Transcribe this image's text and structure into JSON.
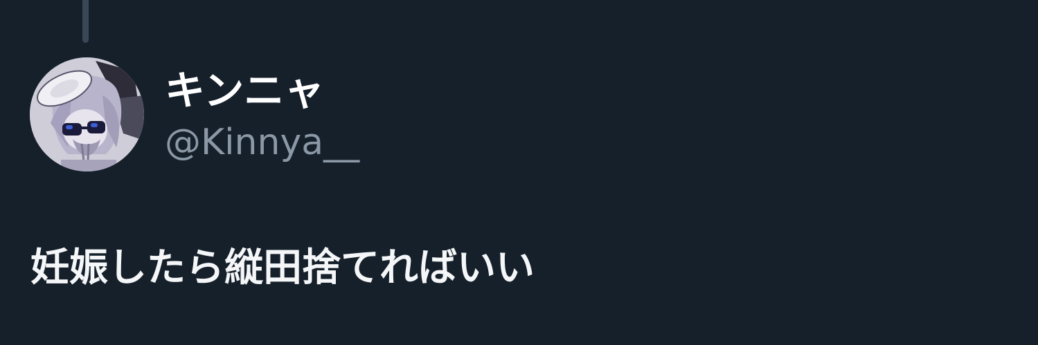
{
  "tweet": {
    "display_name": "キンニャ",
    "handle": "@Kinnya__",
    "text": "妊娠したら縦田捨てればいい",
    "avatar_icon": "user-avatar-anime-character"
  },
  "colors": {
    "background": "#16202b",
    "display_name": "#ffffff",
    "handle": "#8b98a5",
    "text": "#f4f6f8",
    "thread_line": "#3a4756"
  }
}
